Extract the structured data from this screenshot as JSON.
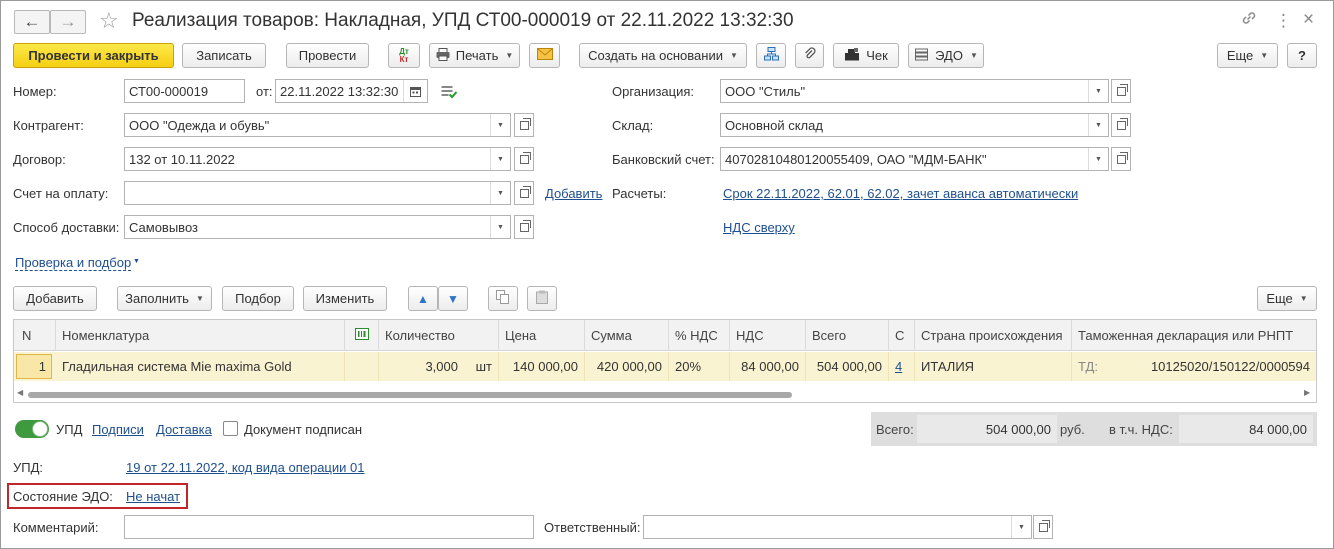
{
  "window": {
    "title": "Реализация товаров: Накладная, УПД СТ00-000019 от 22.11.2022 13:32:30",
    "back": "←",
    "forward": "→",
    "star": "☆",
    "link_icon": "🔗",
    "more_icon": "⋮",
    "close_icon": "×"
  },
  "toolbar": {
    "post_close": "Провести и закрыть",
    "save": "Записать",
    "post": "Провести",
    "dtkt": "Дт Кт",
    "print": "Печать",
    "create_based": "Создать на основании",
    "check": "Чек",
    "edo": "ЭДО",
    "more": "Еще",
    "help": "?"
  },
  "form": {
    "number_label": "Номер:",
    "number_value": "СТ00-000019",
    "date_label": "от:",
    "date_value": "22.11.2022 13:32:30",
    "counterparty_label": "Контрагент:",
    "counterparty_value": "ООО \"Одежда и обувь\"",
    "contract_label": "Договор:",
    "contract_value": "132 от 10.11.2022",
    "invoice_label": "Счет на оплату:",
    "invoice_value": "",
    "add_link": "Добавить",
    "delivery_label": "Способ доставки:",
    "delivery_value": "Самовывоз",
    "org_label": "Организация:",
    "org_value": "ООО \"Стиль\"",
    "warehouse_label": "Склад:",
    "warehouse_value": "Основной склад",
    "bank_label": "Банковский счет:",
    "bank_value": "40702810480120055409, ОАО \"МДМ-БАНК\"",
    "settlements_label": "Расчеты:",
    "settlements_link": "Срок 22.11.2022, 62.01, 62.02, зачет аванса автоматически",
    "vat_link": "НДС сверху",
    "check_selection": "Проверка и подбор"
  },
  "table_toolbar": {
    "add": "Добавить",
    "fill": "Заполнить",
    "selection": "Подбор",
    "edit": "Изменить",
    "more": "Еще"
  },
  "table": {
    "headers": {
      "n": "N",
      "item": "Номенклатура",
      "qty": "Количество",
      "price": "Цена",
      "sum": "Сумма",
      "vat_rate": "% НДС",
      "vat": "НДС",
      "total": "Всего",
      "c": "С",
      "country": "Страна происхождения",
      "customs": "Таможенная декларация или РНПТ"
    },
    "rows": [
      {
        "n": "1",
        "item": "Гладильная система Mie maxima Gold",
        "qty": "3,000",
        "unit": "шт",
        "price": "140 000,00",
        "sum": "420 000,00",
        "vat_rate": "20%",
        "vat": "84 000,00",
        "total": "504 000,00",
        "c": "4",
        "country": "ИТАЛИЯ",
        "customs_prefix": "ТД:",
        "customs": "10125020/150122/0000594"
      }
    ]
  },
  "footer": {
    "upd_toggle": "УПД",
    "signatures": "Подписи",
    "delivery": "Доставка",
    "signed": "Документ подписан",
    "total_label": "Всего:",
    "total_value": "504 000,00",
    "currency": "руб.",
    "vat_incl_label": "в т.ч. НДС:",
    "vat_incl_value": "84 000,00",
    "upd_label": "УПД:",
    "upd_link": "19 от 22.11.2022, код вида операции 01",
    "edo_state_label": "Состояние ЭДО:",
    "edo_state_link": "Не начат",
    "comment_label": "Комментарий:",
    "comment_value": "",
    "responsible_label": "Ответственный:",
    "responsible_value": ""
  },
  "colors": {
    "primary_button": "#f5cf12",
    "row_highlight": "#faf3d2",
    "link": "#1f4f8f",
    "toggle_on": "#3f9a3f",
    "edo_highlight": "#c0262c"
  }
}
